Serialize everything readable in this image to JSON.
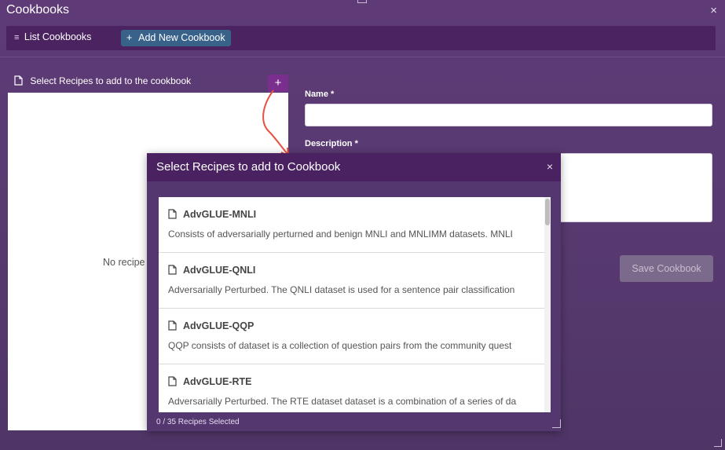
{
  "window": {
    "title": "Cookbooks",
    "close_glyph": "×"
  },
  "nav": {
    "list_icon": "≡",
    "list_label": "List Cookbooks",
    "add_icon": "+",
    "add_label": "Add New Cookbook"
  },
  "left": {
    "header": "Select Recipes to add to the cookbook",
    "add_glyph": "+",
    "empty_text": "No recipe"
  },
  "form": {
    "name_label": "Name *",
    "name_value": "",
    "description_label": "Description *",
    "description_value": "",
    "save_label": "Save Cookbook"
  },
  "modal": {
    "title": "Select Recipes to add to Cookbook",
    "close_glyph": "×",
    "recipes": [
      {
        "name": "AdvGLUE-MNLI",
        "description": "Consists of adversarially perturned and benign MNLI and MNLIMM datasets. MNLI"
      },
      {
        "name": "AdvGLUE-QNLI",
        "description": "Adversarially Perturbed. The QNLI dataset is used for a sentence pair classification"
      },
      {
        "name": "AdvGLUE-QQP",
        "description": "QQP consists of dataset is a collection of question pairs from the community quest"
      },
      {
        "name": "AdvGLUE-RTE",
        "description": "Adversarially Perturbed. The RTE dataset dataset is a combination of a series of da"
      }
    ],
    "selected_count": "0 / 35 Recipes Selected"
  },
  "colors": {
    "background": "#5a3a72",
    "nav_bar": "#4a2360",
    "add_button": "#39628a",
    "save_button_disabled": "#7b6a8c",
    "arrow_annotation": "#e8503f"
  },
  "icons": {
    "document": "document-icon",
    "list": "list-icon",
    "close": "close-icon"
  }
}
